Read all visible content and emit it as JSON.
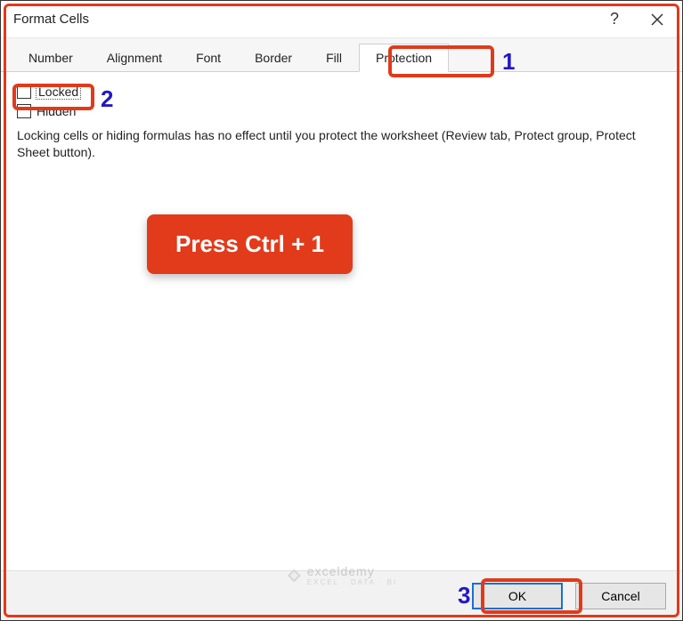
{
  "titlebar": {
    "title": "Format Cells",
    "help_label": "?",
    "close_label": "Close"
  },
  "tabs": [
    {
      "label": "Number"
    },
    {
      "label": "Alignment"
    },
    {
      "label": "Font"
    },
    {
      "label": "Border"
    },
    {
      "label": "Fill"
    },
    {
      "label": "Protection"
    }
  ],
  "active_tab_index": 5,
  "protection": {
    "locked_label": "Locked",
    "locked_checked": false,
    "hidden_label": "Hidden",
    "hidden_checked": false,
    "info": "Locking cells or hiding formulas has no effect until you protect the worksheet (Review tab, Protect group, Protect Sheet button)."
  },
  "overlay": {
    "text": "Press Ctrl + 1"
  },
  "steps": {
    "one": "1",
    "two": "2",
    "three": "3"
  },
  "footer": {
    "ok_label": "OK",
    "cancel_label": "Cancel"
  },
  "watermark": {
    "brand": "exceldemy",
    "tagline": "EXCEL · DATA · BI"
  },
  "colors": {
    "highlight": "#e13a1a",
    "step_number": "#2217c7",
    "button_focus": "#1a6fd6"
  }
}
